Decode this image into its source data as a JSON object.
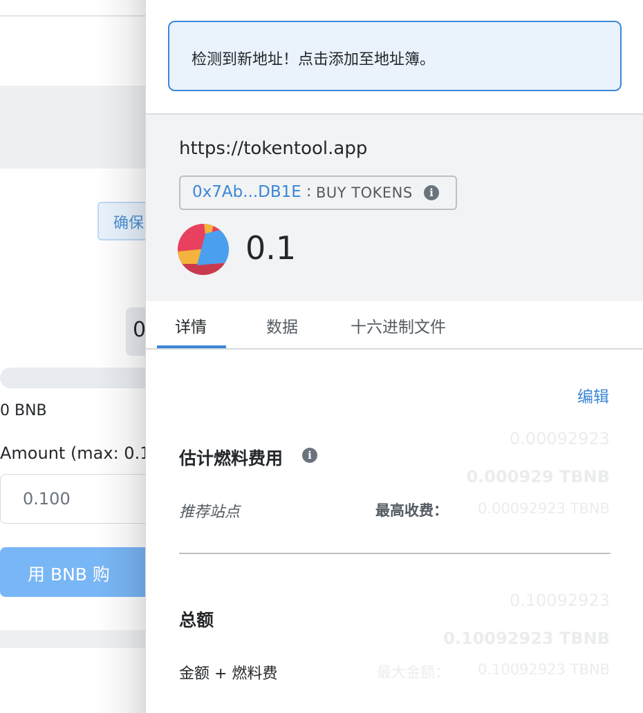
{
  "background_page": {
    "tip_fragment": "确保",
    "number_fragment": "0",
    "balance": "0 BNB",
    "amount_label": "Amount (max: 0.1",
    "amount_input_value": "0.100",
    "buy_button_label": "用 BNB 购"
  },
  "popup": {
    "notice": "检测到新地址！点击添加至地址簿。",
    "origin": "https://tokentool.app",
    "contract_address": "0x7Ab...DB1E",
    "method_separator": ":",
    "method_name": "BUY TOKENS",
    "amount": "0.1",
    "tabs": [
      {
        "label": "详情",
        "active": true
      },
      {
        "label": "数据",
        "active": false
      },
      {
        "label": "十六进制文件",
        "active": false
      }
    ],
    "edit_label": "编辑",
    "gas": {
      "title": "估计燃料费用",
      "secondary_amount": "0.00092923",
      "primary_amount": "0.000929 TBNB",
      "recommended_label": "推荐站点",
      "max_fee_label": "最高收费：",
      "max_fee_value": "0.00092923 TBNB"
    },
    "total": {
      "title": "总额",
      "secondary_amount": "0.10092923",
      "primary_amount": "0.10092923 TBNB",
      "amount_plus_gas_label": "金额 + 燃料费",
      "max_amount_label": "最大金额：",
      "max_amount_value": "0.10092923 TBNB"
    }
  },
  "colors": {
    "accent_blue": "#3a86d6",
    "notice_bg": "#eaf2fb",
    "origin_bg": "#f2f3f4",
    "buy_button": "#79b6f5"
  }
}
